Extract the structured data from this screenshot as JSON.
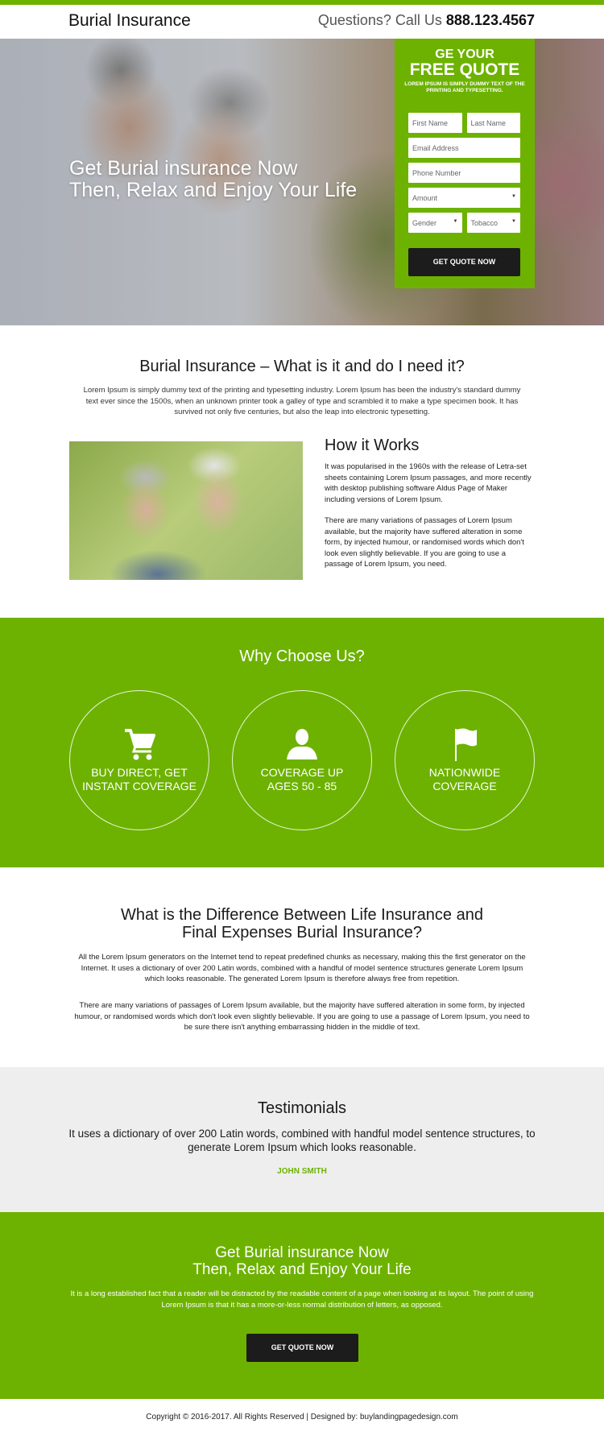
{
  "header": {
    "brand": "Burial Insurance",
    "phone_prefix": "Questions? Call Us ",
    "phone_number": "888.123.4567"
  },
  "hero": {
    "headline_line1": "Get Burial insurance Now",
    "headline_line2": "Then, Relax and Enjoy Your Life",
    "form": {
      "title_line1": "GE YOUR",
      "title_line2": "FREE QUOTE",
      "subtitle": "LOREM IPSUM IS SIMPLY DUMMY TEXT OF THE PRINTING AND TYPESETTING.",
      "first_name_placeholder": "First Name",
      "last_name_placeholder": "Last Name",
      "email_placeholder": "Email Address",
      "phone_placeholder": "Phone Number",
      "amount_select": "Amount",
      "gender_select": "Gender",
      "tobacco_select": "Tobacco",
      "submit_label": "GET QUOTE NOW"
    }
  },
  "what": {
    "title": "Burial Insurance – What is it and do I need it?",
    "intro": "Lorem Ipsum is simply dummy text of the printing and typesetting industry. Lorem Ipsum has been the industry's standard dummy text ever since the 1500s, when an unknown printer took a galley of type and scrambled it to make a type specimen book. It has survived not only five centuries, but also the leap into electronic typesetting.",
    "how_title": "How it Works",
    "how_p1": "It was popularised in the 1960s with the release of Letra-set sheets containing Lorem Ipsum passages, and more recently with desktop publishing software Aldus Page of Maker including versions of Lorem Ipsum.",
    "how_p2": "There are many variations of passages of Lorem Ipsum available, but the majority have suffered alteration in some form, by injected humour, or randomised words which don't look even slightly believable. If you are going to use a passage of Lorem Ipsum, you need."
  },
  "why": {
    "title": "Why Choose Us?",
    "items": [
      {
        "icon": "shopping-cart-icon",
        "line1": "BUY DIRECT, GET",
        "line2": "INSTANT COVERAGE"
      },
      {
        "icon": "user-icon",
        "line1": "COVERAGE UP",
        "line2": "AGES 50 - 85"
      },
      {
        "icon": "flag-icon",
        "line1": "NATIONWIDE",
        "line2": "COVERAGE"
      }
    ]
  },
  "difference": {
    "title_line1": "What is the Difference Between Life Insurance and",
    "title_line2": "Final Expenses Burial Insurance?",
    "p1": "All the Lorem Ipsum generators on the Internet tend to repeat predefined chunks as necessary, making this the first  generator on the Internet. It uses a dictionary of over 200 Latin words, combined with a handful of model sentence structures generate Lorem Ipsum which looks reasonable. The generated Lorem Ipsum is therefore always free from repetition.",
    "p2": "There are many variations of passages of Lorem Ipsum available, but the majority have suffered alteration in some form, by injected humour, or randomised words which don't look even slightly believable. If you are going to use a passage of Lorem Ipsum, you need to be sure there isn't anything embarrassing hidden in the middle of text."
  },
  "testimonials": {
    "title": "Testimonials",
    "quote": "It uses a dictionary of over 200 Latin words, combined with handful model sentence structures, to generate Lorem Ipsum which looks reasonable.",
    "author": "JOHN SMITH"
  },
  "cta": {
    "title_line1": "Get Burial insurance Now",
    "title_line2": "Then, Relax and Enjoy Your Life",
    "text": "It is a long established fact that a reader will be distracted by the readable content of a page when looking at its layout. The point of using Lorem Ipsum is that it has a more-or-less normal distribution of letters, as opposed.",
    "button_label": "GET QUOTE NOW"
  },
  "footer": {
    "text": "Copyright © 2016-2017. All Rights Reserved  |  Designed by: buylandingpagedesign.com"
  },
  "colors": {
    "brand_green": "#6db200",
    "button_dark": "#1c1c1c",
    "testimonial_bg": "#eeeeee"
  }
}
